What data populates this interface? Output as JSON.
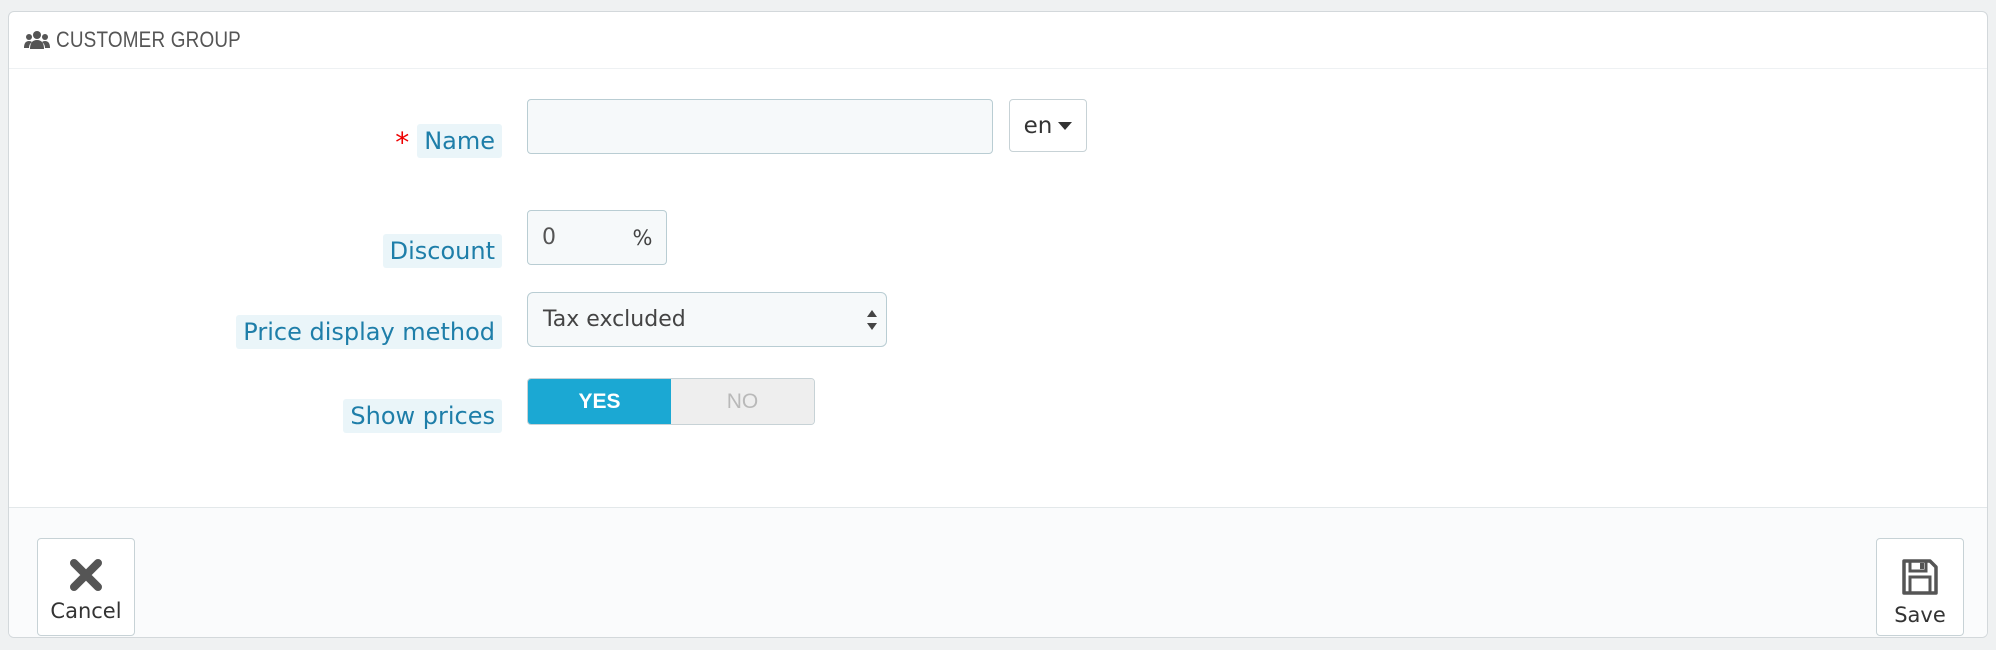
{
  "panel": {
    "title": "CUSTOMER GROUP",
    "icon": "users-icon"
  },
  "form": {
    "name": {
      "required_mark": "*",
      "label": "Name",
      "value": "",
      "placeholder": "",
      "language": "en"
    },
    "discount": {
      "label": "Discount",
      "value": "0",
      "unit": "%"
    },
    "price_display": {
      "label": "Price display method",
      "selected": "Tax excluded"
    },
    "show_prices": {
      "label": "Show prices",
      "yes": "YES",
      "no": "NO",
      "selected": "YES"
    }
  },
  "footer": {
    "cancel_label": "Cancel",
    "save_label": "Save"
  },
  "colors": {
    "accent": "#1ba8d3",
    "label_text": "#1e7ea9",
    "label_bg": "#eaf5f9",
    "required": "#e00000"
  }
}
